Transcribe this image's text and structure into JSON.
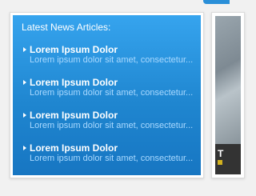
{
  "news": {
    "heading": "Latest News Articles:",
    "items": [
      {
        "title": "Lorem Ipsum Dolor",
        "excerpt": "Lorem ipsum dolor sit amet, consectetur..."
      },
      {
        "title": "Lorem Ipsum Dolor",
        "excerpt": "Lorem ipsum dolor sit amet, consectetur..."
      },
      {
        "title": "Lorem Ipsum Dolor",
        "excerpt": "Lorem ipsum dolor sit amet, consectetur..."
      },
      {
        "title": "Lorem Ipsum Dolor",
        "excerpt": "Lorem ipsum dolor sit amet, consectetur..."
      }
    ]
  },
  "featured": {
    "caption": "T"
  },
  "colors": {
    "panel_blue": "#1f86d0",
    "excerpt_text": "#a9d9ff",
    "caption_bar": "#333333",
    "caption_accent": "#d3b21f"
  }
}
